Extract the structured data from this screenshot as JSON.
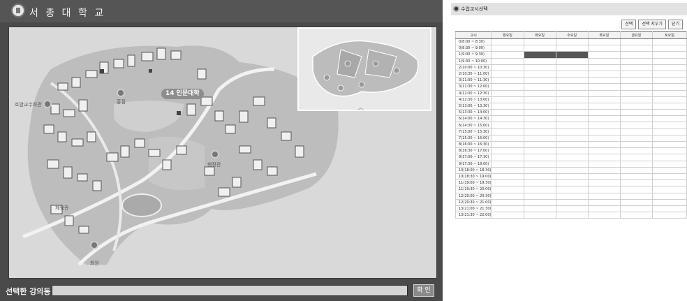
{
  "left_window": {
    "title": "서 총 대 학 교",
    "map": {
      "badge": "14 인문대학",
      "labels": [
        "호암교수회관",
        "홍점",
        "행정관",
        "체육관",
        "화원"
      ]
    },
    "selected_label": "선택한 강의동 :",
    "selected_value": "",
    "confirm_button": "확 인"
  },
  "right_window": {
    "title": "수업교시선택",
    "buttons": [
      "선택",
      "선택 지우기",
      "닫기"
    ],
    "headers": [
      "교시",
      "월요일",
      "화요일",
      "수요일",
      "목요일",
      "금요일",
      "토요일"
    ],
    "periods": [
      "0(8:00 ~ 8:30)",
      "0(8:30 ~ 9:00)",
      "1(9:00 ~ 9:30)",
      "1(9:30 ~ 10:00)",
      "2(10:00 ~ 10:30)",
      "2(10:30 ~ 11:00)",
      "3(11:00 ~ 11:30)",
      "3(11:30 ~ 12:00)",
      "4(12:00 ~ 12:30)",
      "4(12:30 ~ 13:00)",
      "5(13:00 ~ 13:30)",
      "5(13:30 ~ 14:00)",
      "6(14:00 ~ 14:30)",
      "6(14:30 ~ 15:00)",
      "7(15:00 ~ 15:30)",
      "7(15:30 ~ 16:00)",
      "8(16:00 ~ 16:30)",
      "8(16:30 ~ 17:00)",
      "9(17:00 ~ 17:30)",
      "9(17:30 ~ 18:00)",
      "10(18:00 ~ 18:30)",
      "10(18:30 ~ 19:00)",
      "11(19:00 ~ 19:30)",
      "11(19:30 ~ 20:00)",
      "12(20:00 ~ 20:30)",
      "12(20:30 ~ 21:00)",
      "13(21:00 ~ 21:30)",
      "13(21:30 ~ 22:00)"
    ],
    "selected_cells": [
      [
        2,
        2
      ],
      [
        2,
        3
      ]
    ],
    "highlight_cells": [
      [
        0,
        2
      ],
      [
        1,
        2
      ]
    ]
  }
}
